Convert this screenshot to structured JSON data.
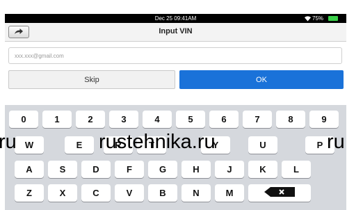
{
  "status_bar": {
    "time": "Dec 25 09:41AM",
    "battery": "75%"
  },
  "nav": {
    "title": "Input VIN"
  },
  "vin_input": {
    "placeholder": "xxx.xxx@gmail.com"
  },
  "buttons": {
    "skip": "Skip",
    "ok": "OK"
  },
  "keyboard": {
    "row1": [
      "0",
      "1",
      "2",
      "3",
      "4",
      "5",
      "6",
      "7",
      "8",
      "9"
    ],
    "row2": [
      "W",
      "E",
      "R",
      "T",
      "Y",
      "U",
      "P"
    ],
    "row3": [
      "A",
      "S",
      "D",
      "F",
      "G",
      "H",
      "J",
      "K",
      "L"
    ],
    "row4": [
      "Z",
      "X",
      "C",
      "V",
      "B",
      "N",
      "M"
    ]
  },
  "watermarks": {
    "left": "ru",
    "center": "rustehnika.ru",
    "right": "ru"
  }
}
